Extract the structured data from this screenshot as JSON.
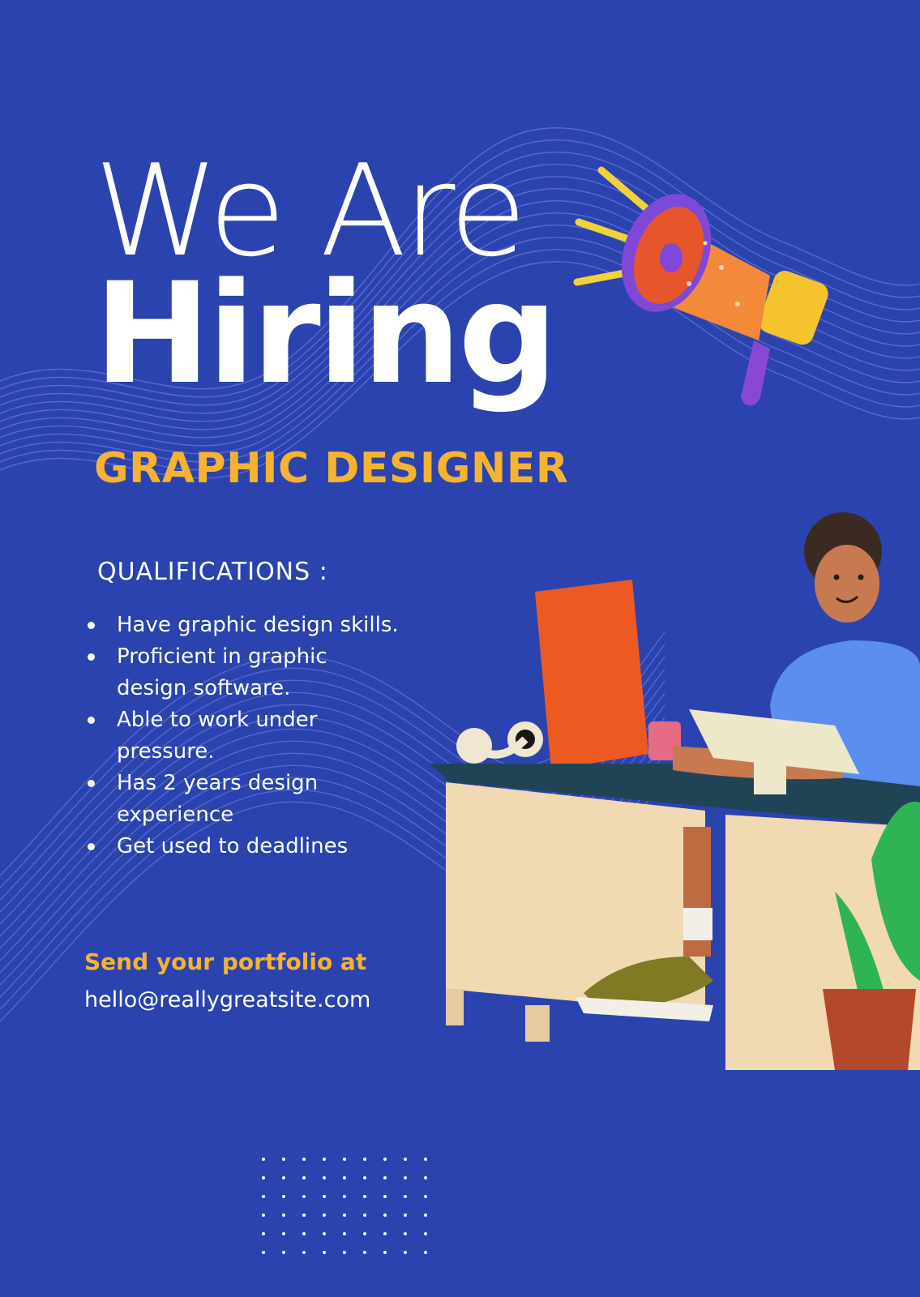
{
  "poster": {
    "headline_light": "We Are",
    "headline_bold": "Hiring",
    "role": "GRAPHIC DESIGNER",
    "qualifications_title": "QUALIFICATIONS :",
    "qualifications": [
      "Have graphic design skills.",
      "Proficient in graphic design software.",
      "Able to work under pressure.",
      "Has 2 years design experience",
      "Get used to deadlines"
    ],
    "contact_label": "Send your portfolio at",
    "contact_email": "hello@reallygreatsite.com"
  },
  "colors": {
    "background": "#2b43af",
    "accent": "#f7b330",
    "text": "#ffffff",
    "wave_lines": "#6a75de"
  },
  "icons": {
    "megaphone": "megaphone-icon",
    "illustration": "designer-at-desk-illustration",
    "dots": "dot-grid-decoration"
  }
}
